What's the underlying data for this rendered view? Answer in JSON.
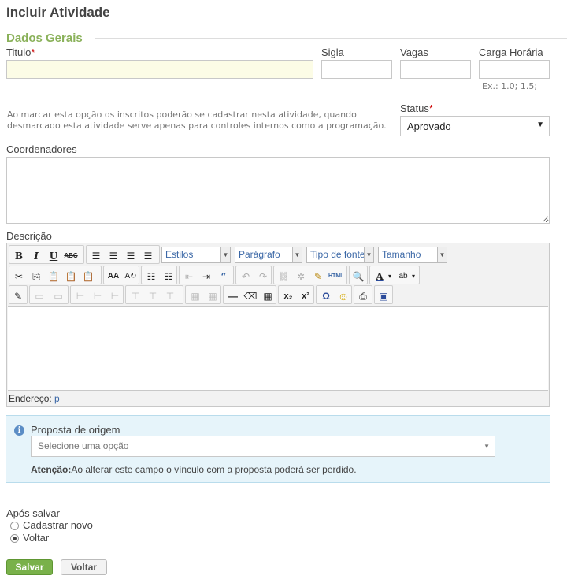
{
  "page": {
    "title": "Incluir Atividade"
  },
  "section": {
    "legend": "Dados Gerais"
  },
  "fields": {
    "titulo": {
      "label": "Titulo",
      "required": "*",
      "value": ""
    },
    "sigla": {
      "label": "Sigla",
      "value": ""
    },
    "vagas": {
      "label": "Vagas",
      "value": ""
    },
    "carga": {
      "label": "Carga Horária",
      "value": "",
      "hint": "Ex.: 1.0; 1.5;"
    },
    "inscricao_note": "Ao marcar esta opção os inscritos poderão se cadastrar nesta atividade, quando desmarcado esta atividade serve apenas para controles internos como a programação.",
    "status": {
      "label": "Status",
      "required": "*",
      "selected": "Aprovado"
    },
    "coordenadores": {
      "label": "Coordenadores",
      "value": ""
    },
    "descricao": {
      "label": "Descrição"
    }
  },
  "editor": {
    "combos": {
      "estilos": "Estilos",
      "paragrafo": "Parágrafo",
      "fonte": "Tipo de fonte",
      "tamanho": "Tamanho"
    },
    "path_label": "Endereço:",
    "path_value": "p"
  },
  "proposta": {
    "label": "Proposta de origem",
    "placeholder": "Selecione uma opção",
    "warning_bold": "Atenção:",
    "warning_text": "Ao alterar este campo o vínculo com a proposta poderá ser perdido."
  },
  "apos_salvar": {
    "label": "Após salvar",
    "options": [
      "Cadastrar novo",
      "Voltar"
    ],
    "selected_index": 1
  },
  "buttons": {
    "save": "Salvar",
    "back": "Voltar"
  },
  "colors": {
    "legend": "#8ab15a",
    "required": "#cc0000",
    "info_bg": "#e6f4fa",
    "save_bg": "#79b14a"
  }
}
